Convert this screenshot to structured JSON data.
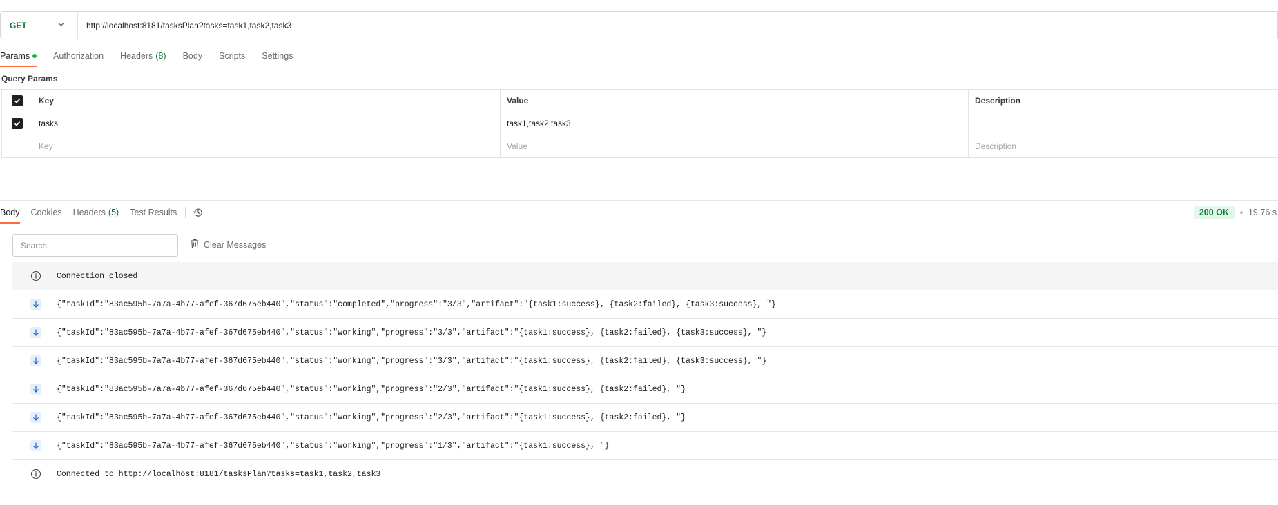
{
  "request": {
    "method": "GET",
    "url": "http://localhost:8181/tasksPlan?tasks=task1,task2,task3"
  },
  "request_tabs": [
    {
      "label": "Params",
      "active": true,
      "dot": true
    },
    {
      "label": "Authorization"
    },
    {
      "label": "Headers",
      "count": "(8)"
    },
    {
      "label": "Body"
    },
    {
      "label": "Scripts"
    },
    {
      "label": "Settings"
    }
  ],
  "query_params": {
    "title": "Query Params",
    "headers": {
      "key": "Key",
      "value": "Value",
      "description": "Description"
    },
    "rows": [
      {
        "checked": true,
        "key": "tasks",
        "value": "task1,task2,task3",
        "description": ""
      }
    ],
    "placeholders": {
      "key": "Key",
      "value": "Value",
      "description": "Description"
    }
  },
  "response_tabs": [
    {
      "label": "Body",
      "active": true
    },
    {
      "label": "Cookies"
    },
    {
      "label": "Headers",
      "count": "(5)"
    },
    {
      "label": "Test Results"
    }
  ],
  "response_status": {
    "code": "200 OK",
    "time": "19.76 s"
  },
  "search": {
    "placeholder": "Search"
  },
  "clear_messages_label": "Clear Messages",
  "messages": [
    {
      "type": "info",
      "text": "Connection closed"
    },
    {
      "type": "incoming",
      "text": "{\"taskId\":\"83ac595b-7a7a-4b77-afef-367d675eb440\",\"status\":\"completed\",\"progress\":\"3/3\",\"artifact\":\"{task1:success}, {task2:failed}, {task3:success}, \"}"
    },
    {
      "type": "incoming",
      "text": "{\"taskId\":\"83ac595b-7a7a-4b77-afef-367d675eb440\",\"status\":\"working\",\"progress\":\"3/3\",\"artifact\":\"{task1:success}, {task2:failed}, {task3:success}, \"}"
    },
    {
      "type": "incoming",
      "text": "{\"taskId\":\"83ac595b-7a7a-4b77-afef-367d675eb440\",\"status\":\"working\",\"progress\":\"3/3\",\"artifact\":\"{task1:success}, {task2:failed}, {task3:success}, \"}"
    },
    {
      "type": "incoming",
      "text": "{\"taskId\":\"83ac595b-7a7a-4b77-afef-367d675eb440\",\"status\":\"working\",\"progress\":\"2/3\",\"artifact\":\"{task1:success}, {task2:failed}, \"}"
    },
    {
      "type": "incoming",
      "text": "{\"taskId\":\"83ac595b-7a7a-4b77-afef-367d675eb440\",\"status\":\"working\",\"progress\":\"2/3\",\"artifact\":\"{task1:success}, {task2:failed}, \"}"
    },
    {
      "type": "incoming",
      "text": "{\"taskId\":\"83ac595b-7a7a-4b77-afef-367d675eb440\",\"status\":\"working\",\"progress\":\"1/3\",\"artifact\":\"{task1:success}, \"}"
    },
    {
      "type": "info",
      "text": "Connected to http://localhost:8181/tasksPlan?tasks=task1,task2,task3"
    }
  ],
  "colors": {
    "accent": "#ff6c37",
    "method_get": "#0b7a34",
    "status_ok_bg": "#e3f7ea",
    "params_dot": "#0cbb52"
  },
  "icons": {
    "method_dropdown": "chevron-down-icon",
    "history": "history-icon",
    "clear": "trash-icon",
    "info": "info-icon",
    "incoming": "arrow-down-icon"
  }
}
